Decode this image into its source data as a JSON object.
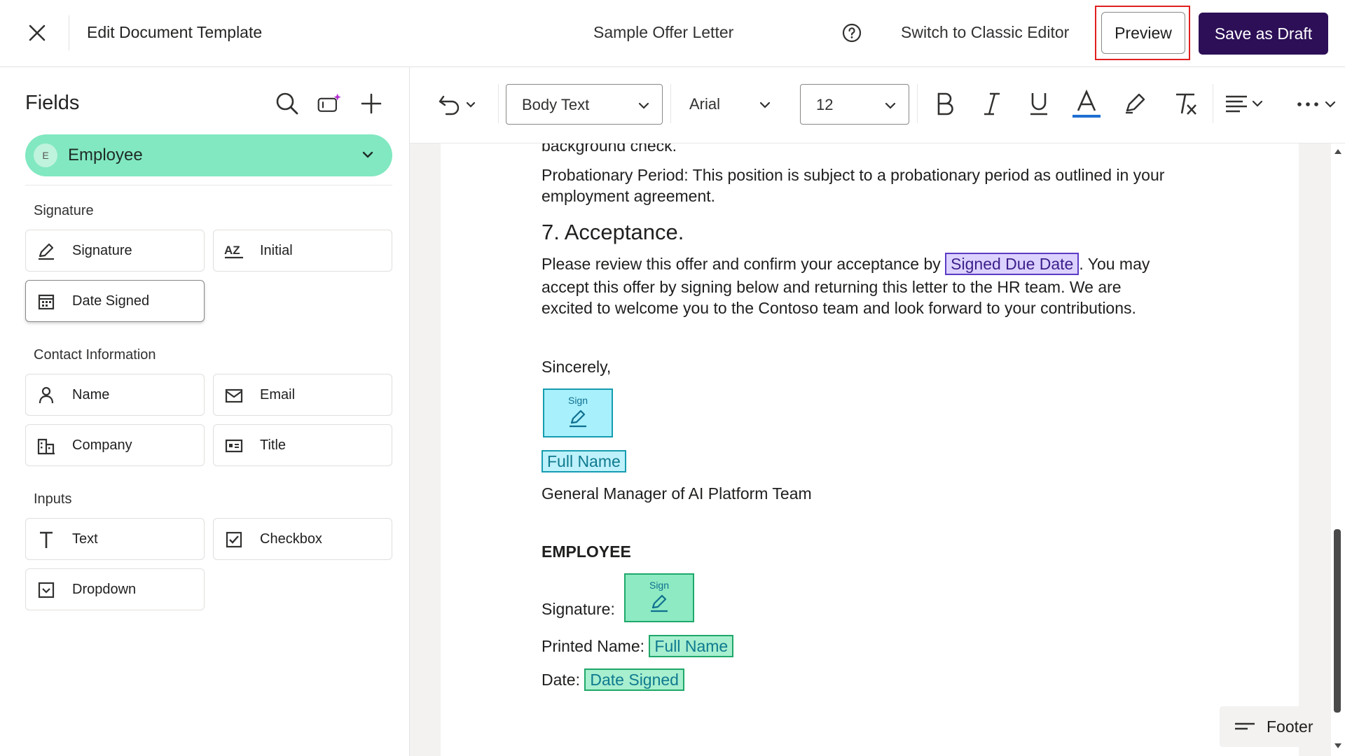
{
  "topbar": {
    "title": "Edit Document Template",
    "document_name": "Sample Offer Letter",
    "classic_editor": "Switch to Classic Editor",
    "preview": "Preview",
    "save_draft": "Save as Draft",
    "icons": [
      "close-icon",
      "help-icon"
    ]
  },
  "sidebar": {
    "title": "Fields",
    "recipient": {
      "initial": "E",
      "name": "Employee",
      "color": "#81e8c1"
    },
    "sections": [
      {
        "title": "Signature",
        "items": [
          "Signature",
          "Initial",
          "Date Signed"
        ]
      },
      {
        "title": "Contact Information",
        "items": [
          "Name",
          "Email",
          "Company",
          "Title"
        ]
      },
      {
        "title": "Inputs",
        "items": [
          "Text",
          "Checkbox",
          "Dropdown"
        ]
      }
    ],
    "icons": [
      "search-icon",
      "ai-field-icon",
      "plus-icon"
    ]
  },
  "toolbar": {
    "style": "Body Text",
    "font": "Arial",
    "size": "12",
    "icons": [
      "undo-icon",
      "bold-icon",
      "italic-icon",
      "underline-icon",
      "font-color-icon",
      "highlight-icon",
      "clear-format-icon",
      "align-icon",
      "more-icon"
    ]
  },
  "document": {
    "line0": "background check.",
    "probation": "Probationary Period: This position is subject to a probationary period as outlined in your",
    "probation2": "employment agreement.",
    "heading": "7. Acceptance.",
    "accept_pre": "Please review this offer and confirm your acceptance by",
    "accept_chip": "Signed Due Date",
    "accept_post": ". You may",
    "accept2": "accept this offer by signing below and returning this letter to the HR team. We are",
    "accept3": "excited to welcome you to the Contoso team and look forward to your contributions.",
    "sincerely": "Sincerely,",
    "sign_label": "Sign",
    "full_name": "Full Name",
    "gm_title": "General Manager of AI Platform Team",
    "employee_heading": "EMPLOYEE",
    "signature_label": "Signature:",
    "printed_name_label": "Printed Name:",
    "date_label": "Date:",
    "date_chip": "Date Signed",
    "footer": "Footer"
  },
  "colors": {
    "primary": "#2c0f57",
    "highlight_box": "#e02020",
    "chip_purple": "#5b3bc4",
    "chip_cyan": "#159cb0",
    "chip_green": "#20a86a"
  }
}
